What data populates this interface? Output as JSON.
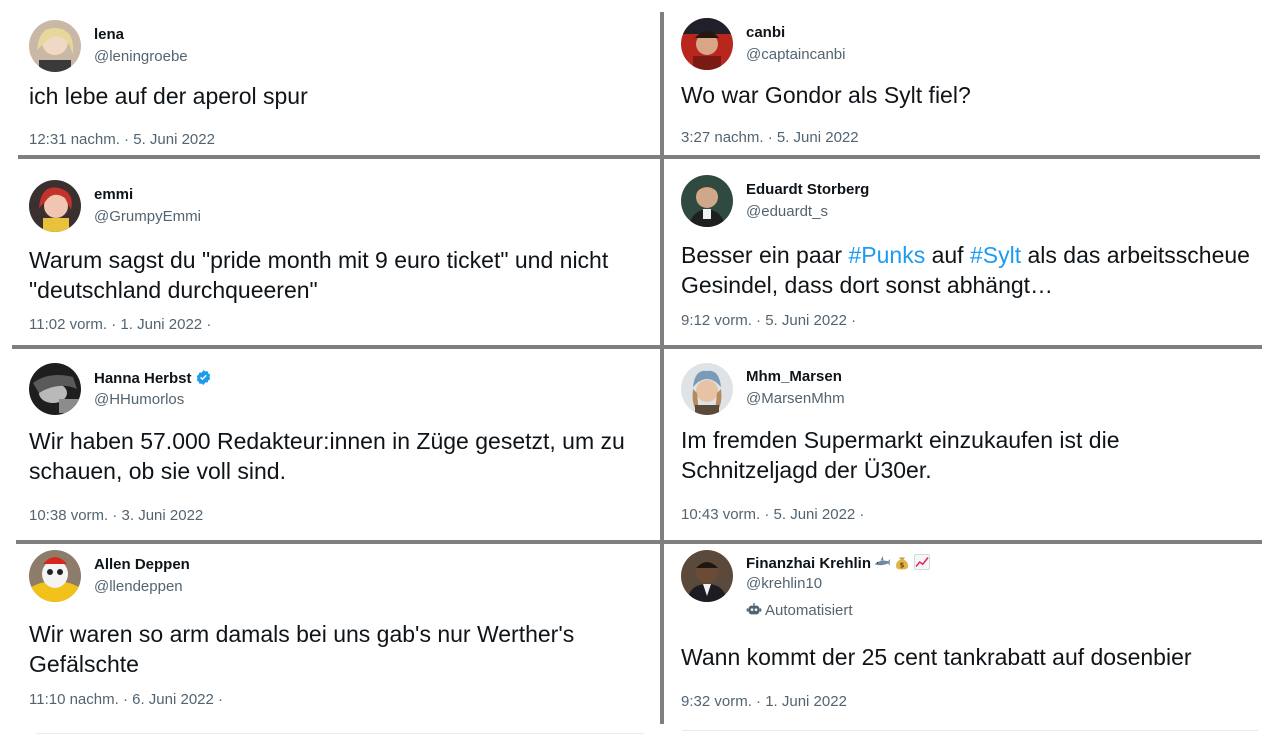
{
  "tweets": [
    {
      "name": "lena",
      "handle": "@leningroebe",
      "text": "ich lebe auf der aperol spur",
      "meta": "12:31 nachm. · 5. Juni 2022"
    },
    {
      "name": "canbi",
      "handle": "@captaincanbi",
      "text": "Wo war Gondor als Sylt fiel?",
      "meta": "3:27 nachm. · 5. Juni 2022"
    },
    {
      "name": "emmi",
      "handle": "@GrumpyEmmi",
      "text": "Warum sagst du \"pride month mit 9 euro ticket\" und nicht \"deutschland durchqueeren\"",
      "meta": "11:02 vorm. · 1. Juni 2022 ·"
    },
    {
      "name": "Eduardt Storberg",
      "handle": "@eduardt_s",
      "text_parts": [
        "Besser ein paar ",
        "#Punks",
        " auf ",
        "#Sylt",
        " als das arbeitsscheue Gesindel, dass dort sonst abhängt…"
      ],
      "meta": "9:12 vorm. · 5. Juni 2022 ·"
    },
    {
      "name": "Hanna Herbst",
      "handle": "@HHumorlos",
      "verified": true,
      "text": "Wir haben 57.000 Redakteur:innen in Züge gesetzt, um zu schauen, ob sie voll sind.",
      "meta": "10:38 vorm. · 3. Juni 2022"
    },
    {
      "name": "Mhm_Marsen",
      "handle": "@MarsenMhm",
      "text": "Im fremden Supermarkt einzukaufen ist die Schnitzeljagd der Ü30er.",
      "meta": "10:43 vorm. · 5. Juni 2022 ·"
    },
    {
      "name": "Allen Deppen",
      "handle": "@llendeppen",
      "text": "Wir waren so arm damals bei uns gab's nur Werther's Gefälschte",
      "meta": "11:10 nachm. · 6. Juni 2022 ·"
    },
    {
      "name": "Finanzhai Krehlin",
      "name_emojis": [
        "shark-emoji",
        "money-bag-emoji",
        "chart-increasing-emoji"
      ],
      "handle": "@krehlin10",
      "label": "Automatisiert",
      "text": "Wann kommt der 25 cent tankrabatt auf dosenbier",
      "meta": "9:32 vorm. · 1. Juni 2022"
    }
  ],
  "colors": {
    "text": "#0f1419",
    "secondary": "#536471",
    "hashtag": "#1d9bf0",
    "verified": "#1d9bf0",
    "divider": "#7f7f7f"
  }
}
